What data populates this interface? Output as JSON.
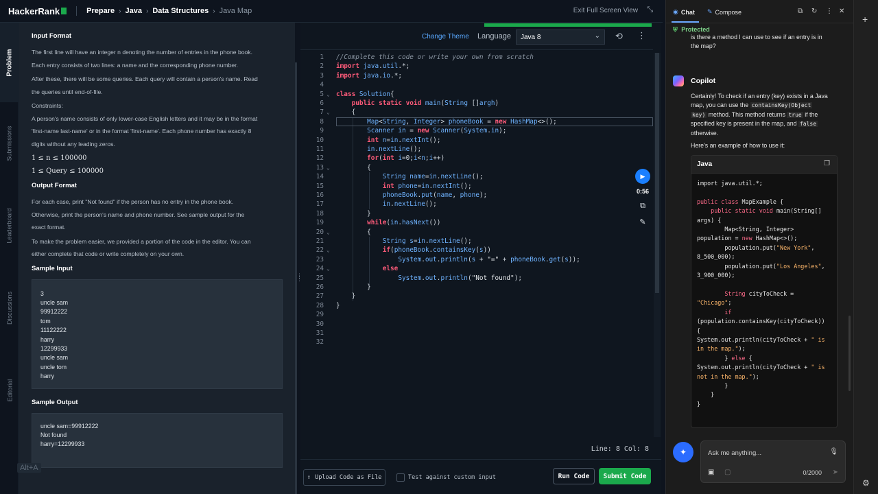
{
  "topbar": {
    "logo": "HackerRank",
    "crumbs": [
      "Prepare",
      "Java",
      "Data Structures"
    ],
    "crumb_current": "Java Map",
    "exit_fullscreen": "Exit Full Screen View"
  },
  "vtabs": [
    "Problem",
    "Submissions",
    "Leaderboard",
    "Discussions",
    "Editorial"
  ],
  "problem": {
    "input_format_title": "Input Format",
    "input_p1": "The first line will have an integer n denoting the number of entries in the phone book.",
    "input_p2": "Each entry consists of two lines: a name and the corresponding phone number.",
    "input_p3": "After these, there will be some queries. Each query will contain a person's name. Read",
    "input_p4": "the queries until end-of-file.",
    "constraints_title": "Constraints:",
    "constraints_p1": "A person's name consists of only lower-case English letters and it may be in the format",
    "constraints_p2": "'first-name last-name' or in the format 'first-name'. Each phone number has exactly 8",
    "constraints_p3": "digits without any leading zeros.",
    "math1": "1 ≤ n ≤ 100000",
    "math2": "1 ≤ Query ≤ 100000",
    "output_format_title": "Output Format",
    "output_p1": "For each case, print \"Not found\" if the person has no entry in the phone book.",
    "output_p2": "Otherwise, print the person's name and phone number. See sample output for the",
    "output_p3": "exact format.",
    "output_p4": "To make the problem easier, we provided a portion of the code in the editor. You can",
    "output_p5": "either complete that code or write completely on your own.",
    "sample_input_title": "Sample Input",
    "sample_input": [
      "3",
      "uncle sam",
      "99912222",
      "tom",
      "11122222",
      "harry",
      "12299933",
      "uncle sam",
      "uncle tom",
      "harry"
    ],
    "sample_output_title": "Sample Output",
    "sample_output": [
      "uncle sam=99912222",
      "Not found",
      "harry=12299933"
    ],
    "alt_badge": "Alt+A"
  },
  "editor": {
    "change_theme": "Change Theme",
    "language_label": "Language",
    "language_value": "Java 8",
    "timer": "0:56",
    "status": "Line: 8  Col: 8",
    "upload_label": "Upload Code as File",
    "custom_input_label": "Test against custom input",
    "run_label": "Run Code",
    "submit_label": "Submit Code",
    "line_numbers": [
      "1",
      "2",
      "3",
      "4",
      "5",
      "6",
      "7",
      "8",
      "9",
      "10",
      "11",
      "12",
      "13",
      "14",
      "15",
      "16",
      "17",
      "18",
      "19",
      "20",
      "21",
      "22",
      "23",
      "24",
      "25",
      "26",
      "27",
      "28",
      "29",
      "30",
      "31",
      "32"
    ],
    "code_lines": [
      "//Complete this code or write your own from scratch",
      "import java.util.*;",
      "import java.io.*;",
      "",
      "class Solution{",
      "    public static void main(String []argh)",
      "    {",
      "        Map<String, Integer> phoneBook = new HashMap<>();",
      "        Scanner in = new Scanner(System.in);",
      "        int n=in.nextInt();",
      "        in.nextLine();",
      "        for(int i=0;i<n;i++)",
      "        {",
      "            String name=in.nextLine();",
      "            int phone=in.nextInt();",
      "            phoneBook.put(name, phone);",
      "            in.nextLine();",
      "        }",
      "        while(in.hasNext())",
      "        {",
      "            String s=in.nextLine();",
      "            if(phoneBook.containsKey(s))",
      "                System.out.println(s + \"=\" + phoneBook.get(s));",
      "            else",
      "                System.out.println(\"Not found\");",
      "        }",
      "    }",
      "}",
      "",
      "",
      "",
      ""
    ]
  },
  "copilot": {
    "tab_chat": "Chat",
    "tab_compose": "Compose",
    "protected": "Protected",
    "prev_message": [
      "is there a method I can use to see if an entry is in",
      "the map?"
    ],
    "assistant_name": "Copilot",
    "answer_p1a": "Certainly! To check if an entry (key) exists in a Java",
    "answer_p1b": "map, you can use the",
    "answer_code1": "containsKey(Object",
    "answer_code2": "key)",
    "answer_p1c": "method. This method returns",
    "answer_code3": "true",
    "answer_p1d": "if the",
    "answer_p1e": "specified key is present in the map, and",
    "answer_code4": "false",
    "answer_p1f": "otherwise.",
    "answer_p2": "Here's an example of how to use it:",
    "code_lang": "Java",
    "input_placeholder": "Ask me anything...",
    "char_count": "0/2000"
  },
  "colors": {
    "accent_green": "#1ba94c",
    "accent_blue": "#1a7fff",
    "keyword": "#ff5b7a"
  }
}
